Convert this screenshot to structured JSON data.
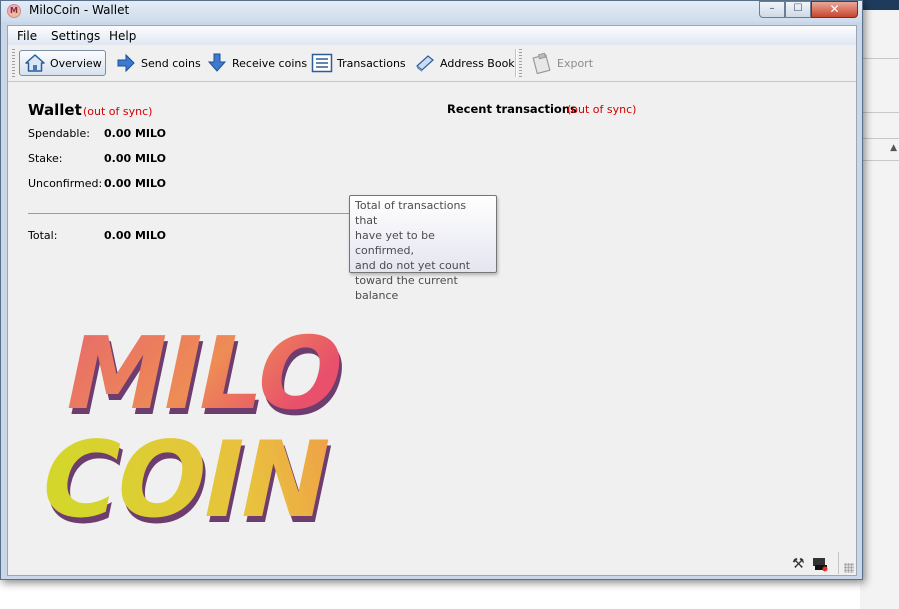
{
  "window": {
    "title": "MiloCoin - Wallet",
    "app_icon": "milocoin-app-icon",
    "controls": {
      "minimize": "minimize-icon",
      "maximize": "maximize-icon",
      "close": "close-icon"
    }
  },
  "menu": {
    "items": [
      "File",
      "Settings",
      "Help"
    ]
  },
  "toolbar": {
    "buttons": [
      {
        "label": "Overview",
        "icon": "home-icon",
        "active": true
      },
      {
        "label": "Send coins",
        "icon": "send-arrow-icon"
      },
      {
        "label": "Receive coins",
        "icon": "receive-arrow-icon"
      },
      {
        "label": "Transactions",
        "icon": "list-icon"
      },
      {
        "label": "Address Book",
        "icon": "address-book-icon"
      },
      {
        "label": "Export",
        "icon": "export-clipboard-icon",
        "disabled": true
      }
    ]
  },
  "wallet": {
    "title": "Wallet",
    "sync_status": "(out of sync)",
    "rows": [
      {
        "label": "Spendable:",
        "value": "0.00 MILO"
      },
      {
        "label": "Stake:",
        "value": "0.00 MILO"
      },
      {
        "label": "Unconfirmed:",
        "value": "0.00 MILO"
      }
    ],
    "total": {
      "label": "Total:",
      "value": "0.00 MILO"
    }
  },
  "recent": {
    "title": "Recent transactions",
    "sync_status": "(out of sync)"
  },
  "tooltip": {
    "lines": [
      "Total of transactions that",
      "have yet to be confirmed,",
      "and do not yet count",
      "toward the current",
      "balance"
    ]
  },
  "logo": {
    "line1": "MILO",
    "line2": "COIN"
  },
  "status_bar": {
    "icons": [
      "staking-tools-icon",
      "network-offline-icon"
    ]
  },
  "colors": {
    "accent_out_of_sync": "#d40000",
    "logo_pink": "#e8506b",
    "logo_orange": "#f0984a",
    "logo_yellow": "#d4d62c",
    "logo_shadow": "#6e3d6f"
  }
}
